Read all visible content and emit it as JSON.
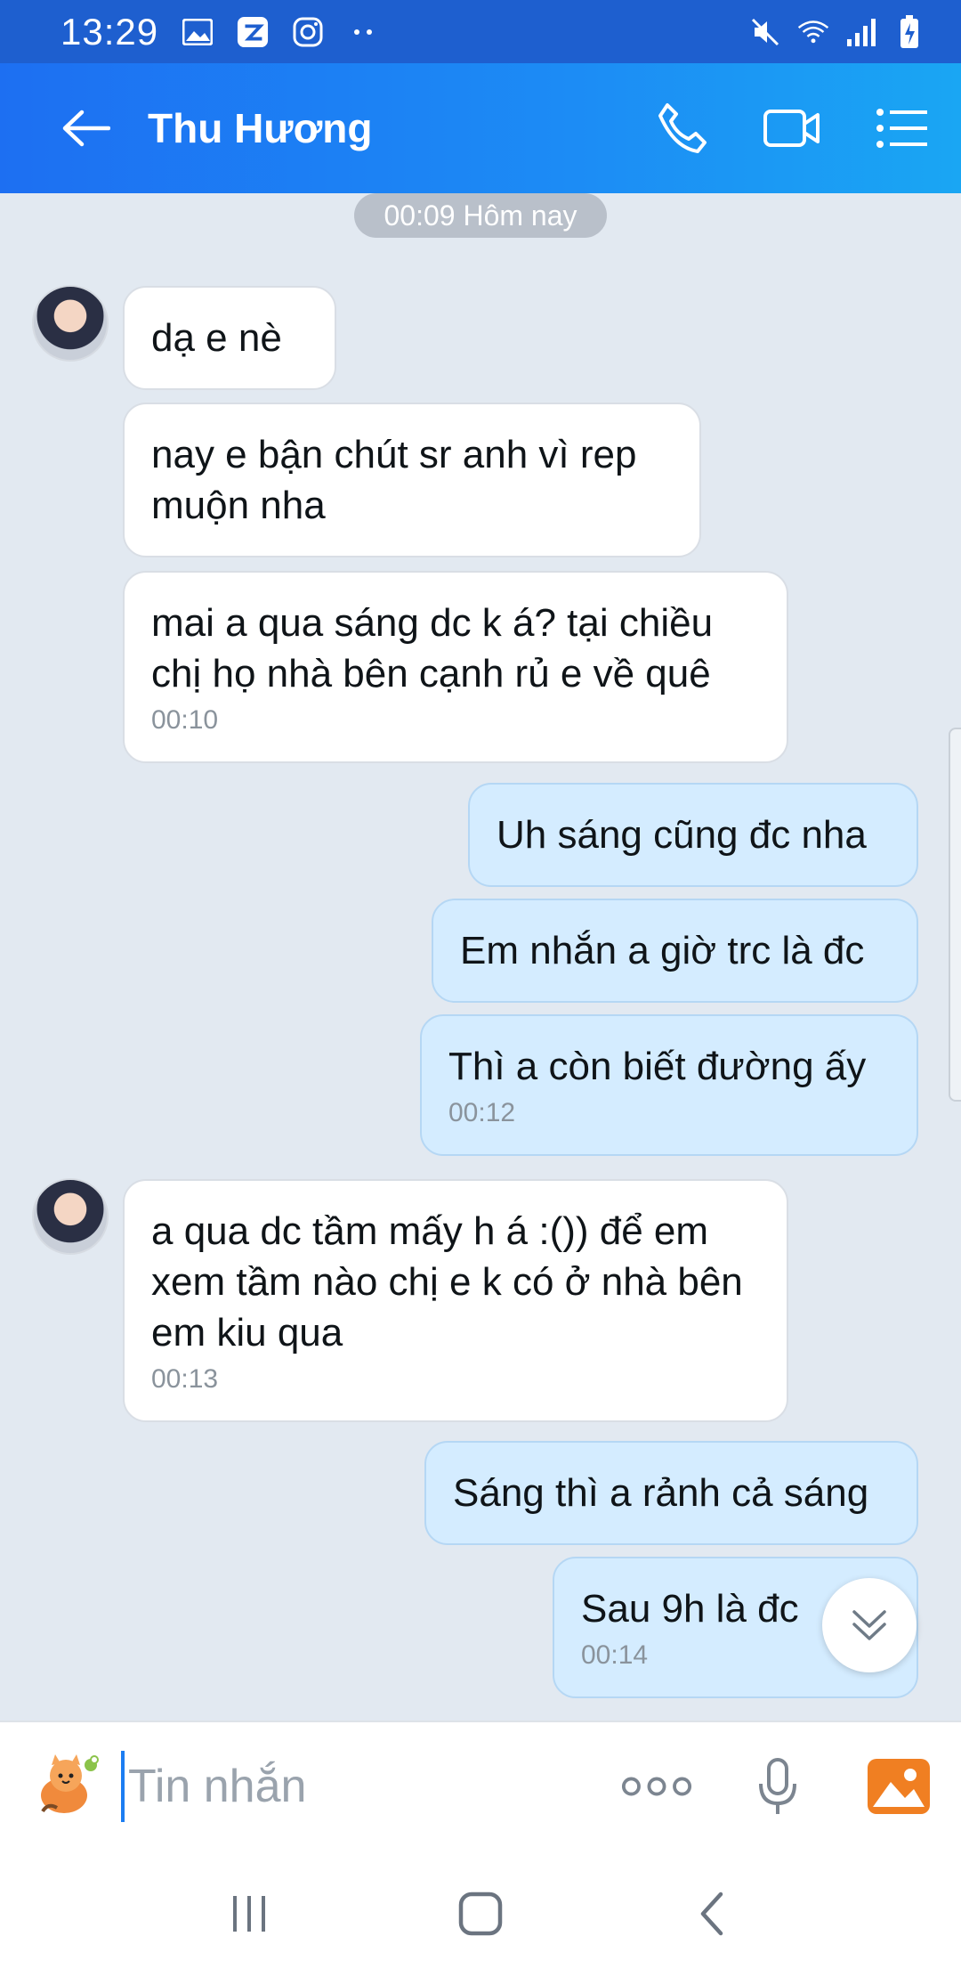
{
  "status_bar": {
    "time": "13:29",
    "left_icons": [
      "image-icon",
      "zalo-icon",
      "instagram-icon",
      "more-dots-icon"
    ],
    "right_icons": [
      "mute-icon",
      "wifi-icon",
      "signal-icon",
      "battery-charging-icon"
    ]
  },
  "header": {
    "title": "Thu Hương",
    "back_icon": "arrow-left-icon",
    "actions": [
      "phone-icon",
      "video-icon",
      "menu-list-icon"
    ]
  },
  "chat": {
    "date_pill": "00:09 Hôm nay",
    "messages": [
      {
        "direction": "in",
        "text": "dạ e nè",
        "time": ""
      },
      {
        "direction": "in",
        "text": "nay e bận chút sr anh vì rep muộn nha",
        "time": ""
      },
      {
        "direction": "in",
        "text": "mai a qua sáng dc k á? tại chiều chị họ nhà bên cạnh rủ e về quê",
        "time": "00:10"
      },
      {
        "direction": "out",
        "text": "Uh sáng cũng đc nha",
        "time": ""
      },
      {
        "direction": "out",
        "text": "Em nhắn a giờ trc là đc",
        "time": ""
      },
      {
        "direction": "out",
        "text": "Thì a còn biết đường ấy",
        "time": "00:12"
      },
      {
        "direction": "in",
        "text": "a qua dc tầm mấy h á :()) để em xem tầm nào chị e k có ở nhà bên em kiu qua",
        "time": "00:13"
      },
      {
        "direction": "out",
        "text": "Sáng thì a rảnh cả sáng",
        "time": ""
      },
      {
        "direction": "out",
        "text": "Sau 9h là đc",
        "time": "00:14"
      }
    ]
  },
  "input_bar": {
    "placeholder": "Tin nhắn",
    "icons": [
      "sticker-icon",
      "more-icon",
      "microphone-icon",
      "photo-icon"
    ]
  },
  "nav_bar": {
    "icons": [
      "recent-apps-icon",
      "home-icon",
      "back-icon"
    ]
  },
  "colors": {
    "header_start": "#1d6ff2",
    "header_end": "#1aa6f3",
    "outgoing_bubble": "#d4ecff",
    "incoming_bubble": "#ffffff",
    "chat_background": "#e2e9f1"
  }
}
